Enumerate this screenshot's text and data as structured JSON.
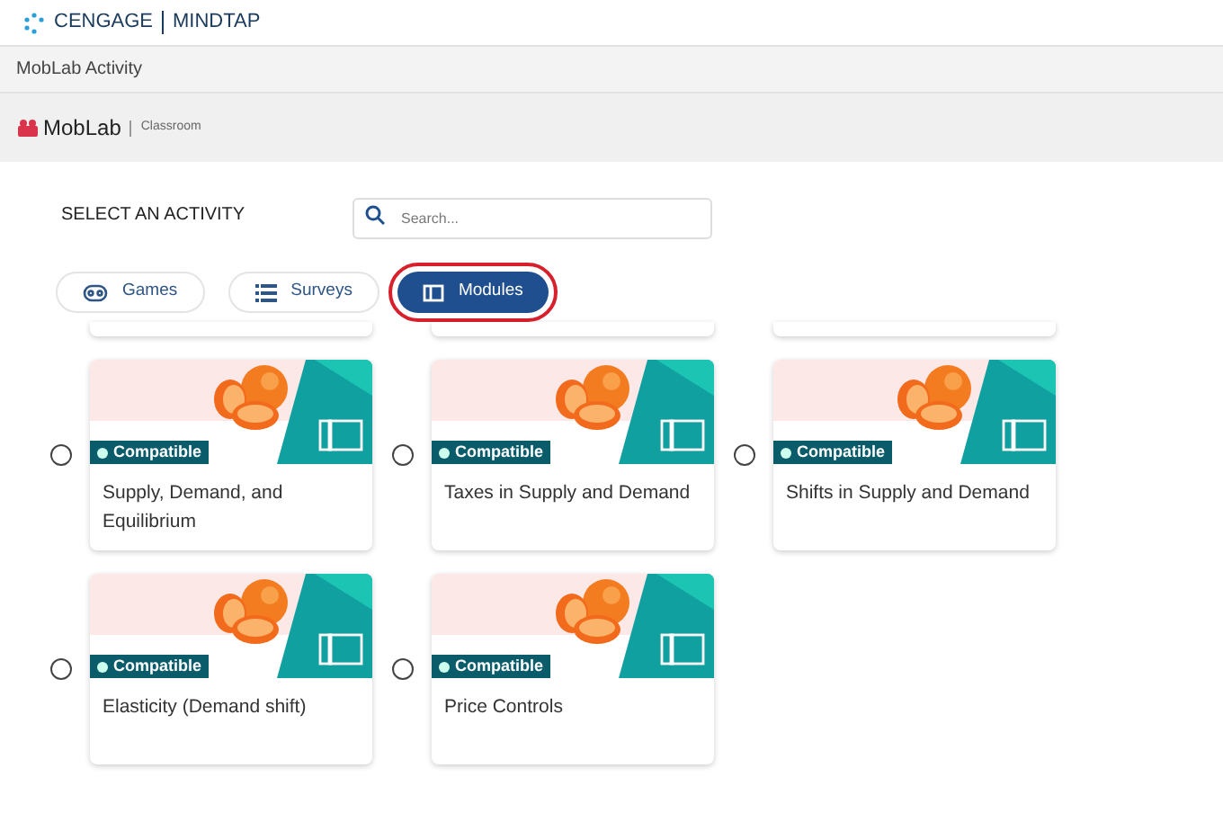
{
  "brand": {
    "left": "CENGAGE",
    "right": "MINDTAP"
  },
  "page_title": "MobLab Activity",
  "app_header": {
    "logo": "MobLab",
    "subtitle": "Classroom"
  },
  "heading": "SELECT AN ACTIVITY",
  "search": {
    "placeholder": "Search..."
  },
  "tabs": [
    {
      "label": "Games",
      "kind": "games",
      "selected": false,
      "highlighted": false
    },
    {
      "label": "Surveys",
      "kind": "surveys",
      "selected": false,
      "highlighted": false
    },
    {
      "label": "Modules",
      "kind": "modules",
      "selected": true,
      "highlighted": true
    }
  ],
  "activities": [
    {
      "title": "Supply, Demand, and Equilibrium",
      "badge": "Compatible",
      "selected": false
    },
    {
      "title": "Taxes in Supply and Demand",
      "badge": "Compatible",
      "selected": false
    },
    {
      "title": "Shifts in Supply and Demand",
      "badge": "Compatible",
      "selected": false
    },
    {
      "title": "Elasticity (Demand shift)",
      "badge": "Compatible",
      "selected": false
    },
    {
      "title": "Price Controls",
      "badge": "Compatible",
      "selected": false
    }
  ]
}
